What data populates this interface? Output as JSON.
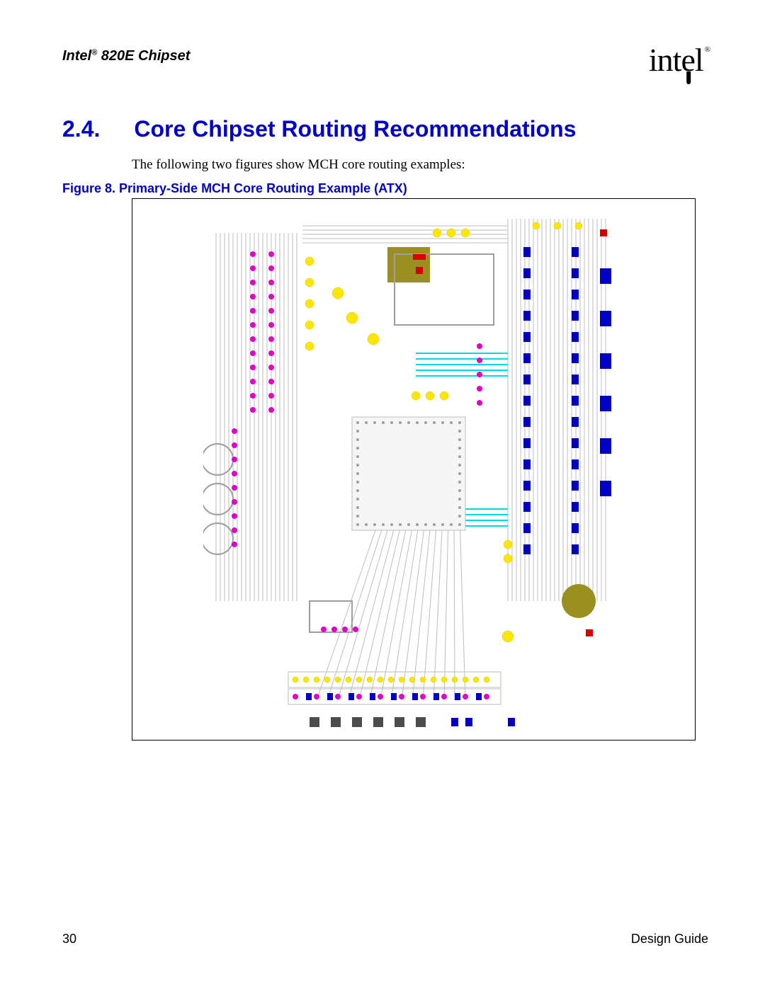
{
  "header": {
    "product_line": "Intel",
    "reg": "®",
    "product_tail": " 820E Chipset"
  },
  "logo": {
    "text": "intel",
    "reg": "®"
  },
  "section": {
    "number": "2.4.",
    "title": "Core Chipset Routing Recommendations"
  },
  "intro": "The following two figures show MCH core routing examples:",
  "figure": {
    "label": "Figure 8. Primary-Side MCH Core Routing Example (ATX)"
  },
  "footer": {
    "page": "30",
    "doc": "Design Guide"
  }
}
